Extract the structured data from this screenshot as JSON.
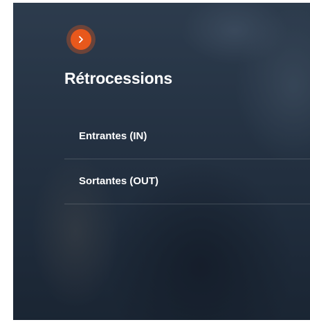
{
  "panel": {
    "title": "Rétrocessions",
    "expand_icon": "chevron-right-icon",
    "accent_color": "#e8581c",
    "menu": [
      {
        "label": "Entrantes (IN)"
      },
      {
        "label": "Sortantes (OUT)"
      }
    ]
  }
}
